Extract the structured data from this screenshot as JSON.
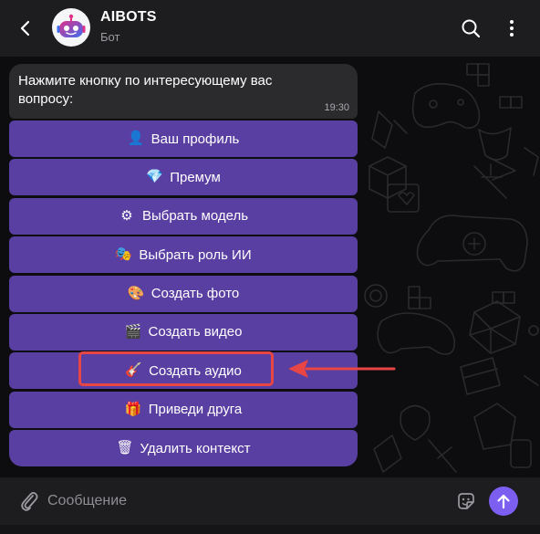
{
  "header": {
    "title": "AIBOTS",
    "subtitle": "Бот",
    "icons": {
      "back": "chevron-left-icon",
      "search": "search-icon",
      "menu": "more-vertical-icon"
    }
  },
  "message": {
    "text": "Нажмите кнопку по интересующему вас вопросу:",
    "time": "19:30"
  },
  "keyboard": [
    {
      "emoji": "👤",
      "label": "Ваш профиль"
    },
    {
      "emoji": "💎",
      "label": "Премум"
    },
    {
      "emoji": "⚙",
      "label": "Выбрать модель"
    },
    {
      "emoji": "🎭",
      "label": "Выбрать роль ИИ"
    },
    {
      "emoji": "🎨",
      "label": "Создать фото"
    },
    {
      "emoji": "🎬",
      "label": "Создать видео"
    },
    {
      "emoji": "🎸",
      "label": "Создать аудио"
    },
    {
      "emoji": "🎁",
      "label": "Приведи друга"
    },
    {
      "emoji": "🗑",
      "label": "Удалить контекст"
    }
  ],
  "annotation": {
    "highlighted_button": "Создать аудио",
    "color": "#e84545"
  },
  "input": {
    "placeholder": "Сообщение"
  },
  "colors": {
    "header_bg": "#1d1d1f",
    "chat_bg": "#0d0d0f",
    "bubble_bg": "#2b2b2e",
    "button_bg": "#5a3fa2",
    "send_bg": "#7c5ff0"
  }
}
